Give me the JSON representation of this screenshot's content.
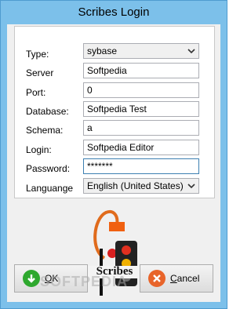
{
  "window": {
    "title": "Scribes Login"
  },
  "form": {
    "type_label": "Type:",
    "type_value": "sybase",
    "server_label": "Server",
    "server_value": "Softpedia",
    "port_label": "Port:",
    "port_value": "0",
    "database_label": "Database:",
    "database_value": "Softpedia Test",
    "schema_label": "Schema:",
    "schema_value": "a",
    "login_label": "Login:",
    "login_value": "Softpedia Editor",
    "password_label": "Password:",
    "password_value": "*******",
    "language_label": "Languange",
    "language_value": "English (United States)"
  },
  "logo": {
    "text": "Scribes"
  },
  "buttons": {
    "ok_mnemonic": "O",
    "ok_rest": "K",
    "cancel_mnemonic": "C",
    "cancel_rest": "ancel"
  },
  "watermark": "SOFTPEDIA",
  "colors": {
    "title_bar": "#7cc0ea",
    "ok_icon": "#2ea82e",
    "cancel_icon": "#e8642a"
  }
}
